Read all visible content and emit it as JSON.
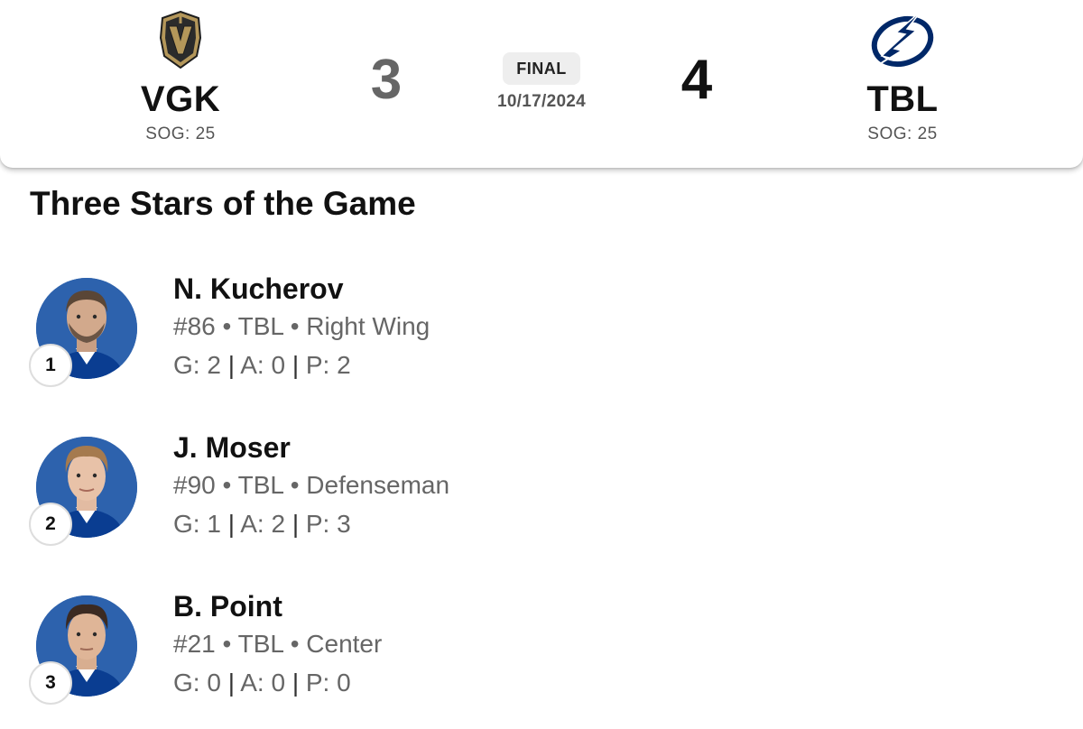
{
  "game": {
    "status": "FINAL",
    "date": "10/17/2024",
    "away": {
      "abbr": "VGK",
      "score": "3",
      "sog": "SOG: 25",
      "logo_icon": "golden-knights-helmet-icon",
      "color": "#B4975A"
    },
    "home": {
      "abbr": "TBL",
      "score": "4",
      "sog": "SOG: 25",
      "logo_icon": "lightning-bolt-icon",
      "color": "#002868"
    }
  },
  "section_title": "Three Stars of the Game",
  "stars": [
    {
      "rank": "1",
      "name": "N. Kucherov",
      "number": "#86",
      "team": "TBL",
      "position": "Right Wing",
      "g": "G: 2",
      "a": "A: 0",
      "p": "P: 2"
    },
    {
      "rank": "2",
      "name": "J. Moser",
      "number": "#90",
      "team": "TBL",
      "position": "Defenseman",
      "g": "G: 1",
      "a": "A: 2",
      "p": "P: 3"
    },
    {
      "rank": "3",
      "name": "B. Point",
      "number": "#21",
      "team": "TBL",
      "position": "Center",
      "g": "G: 0",
      "a": "A: 0",
      "p": "P: 0"
    }
  ],
  "meta_separator": "•",
  "stat_separator": "|"
}
